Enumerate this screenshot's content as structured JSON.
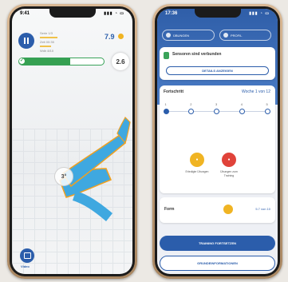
{
  "left_phone": {
    "status": {
      "time": "9:41",
      "signal": "▮▮▮ ◔ ▭"
    },
    "stats": {
      "line1": "Serie 1/3",
      "line2": "Zeit 00:35",
      "line3": "Wdh 8/10"
    },
    "score": "7.9",
    "progress_fraction": 0.6,
    "progress_count": "2.6",
    "angle": "3°",
    "video_label": "Video"
  },
  "right_phone": {
    "status": {
      "time": "17:36",
      "signal": "▮▮▮ ◔ ▭"
    },
    "tabs": [
      "ÜBUNGEN",
      "PROFIL"
    ],
    "sensors": {
      "title": "Sensoren sind verbunden",
      "button": "DETAILS ANZEIGEN"
    },
    "progress": {
      "label": "Fortschritt",
      "week": "Woche 1 von 12",
      "steps": [
        "1",
        "2",
        "3",
        "4",
        "5"
      ],
      "done_label": "Erledigte Übungen",
      "open_label": "Übungen zum Training"
    },
    "form": {
      "label": "Form",
      "value": "5.7 von 10"
    },
    "primary_button": "TRAINING FORTSETZEN",
    "secondary_button": "GRUNDEINFORMATIONEN"
  },
  "colors": {
    "accent": "#2b5dab",
    "success": "#36a052",
    "gold": "#f0b423",
    "red": "#e0433a",
    "leg": "#3fa8e0",
    "outline": "#f0a020"
  }
}
